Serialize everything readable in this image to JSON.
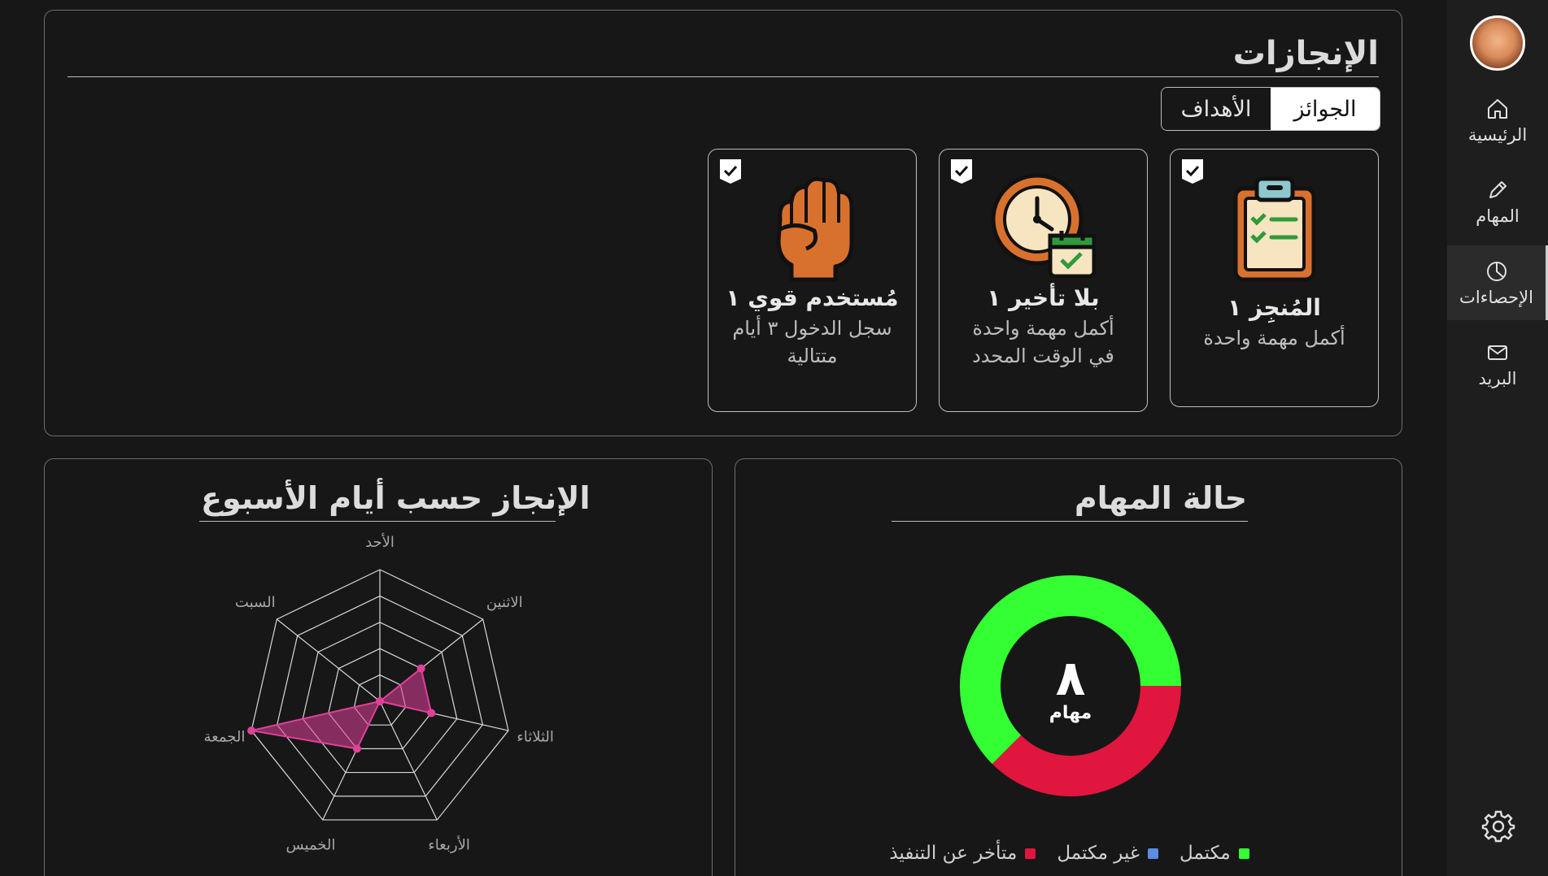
{
  "sidebar": {
    "items": [
      {
        "label": "الرئيسية",
        "icon": "home-icon"
      },
      {
        "label": "المهام",
        "icon": "pencil-icon"
      },
      {
        "label": "الإحصاءات",
        "icon": "pie-chart-icon"
      },
      {
        "label": "البريد",
        "icon": "mail-icon"
      }
    ],
    "active": "الإحصاءات",
    "settings_icon": "gear-icon"
  },
  "achievements": {
    "title": "الإنجازات",
    "tabs": [
      {
        "label": "الجوائز",
        "active": true
      },
      {
        "label": "الأهداف",
        "active": false
      }
    ],
    "cards": [
      {
        "name": "المُنجِز ١",
        "desc": "أكمل مهمة واحدة",
        "icon": "clipboard-checklist-icon"
      },
      {
        "name": "بلا تأخير ١",
        "desc": "أكمل مهمة واحدة في الوقت المحدد",
        "icon": "clock-calendar-icon"
      },
      {
        "name": "مُستخدم قوي ١",
        "desc": "سجل الدخول ٣ أيام متتالية",
        "icon": "fist-icon"
      }
    ]
  },
  "task_status": {
    "title": "حالة المهام",
    "total": "٨",
    "total_label": "مهام",
    "legend": [
      {
        "label": "مكتمل",
        "color": "#33ff33"
      },
      {
        "label": "غير مكتمل",
        "color": "#5b8de6"
      },
      {
        "label": "متأخر عن التنفيذ",
        "color": "#e0163f"
      }
    ]
  },
  "weekly": {
    "title": "الإنجاز حسب أيام الأسبوع"
  },
  "chart_data": [
    {
      "type": "pie",
      "variant": "donut",
      "title": "حالة المهام",
      "labels": [
        "مكتمل",
        "غير مكتمل",
        "متأخر عن التنفيذ"
      ],
      "values": [
        5,
        0,
        3
      ],
      "colors": [
        "#33ff33",
        "#5b8de6",
        "#e0163f"
      ]
    },
    {
      "type": "radar",
      "title": "الإنجاز حسب أيام الأسبوع",
      "categories": [
        "الأحد",
        "الاثنين",
        "الثلاثاء",
        "الأربعاء",
        "الخميس",
        "الجمعة",
        "السبت"
      ],
      "values": [
        0,
        2,
        2,
        0,
        2,
        5,
        0
      ],
      "rmax": 5,
      "color": "#e0409a"
    }
  ]
}
